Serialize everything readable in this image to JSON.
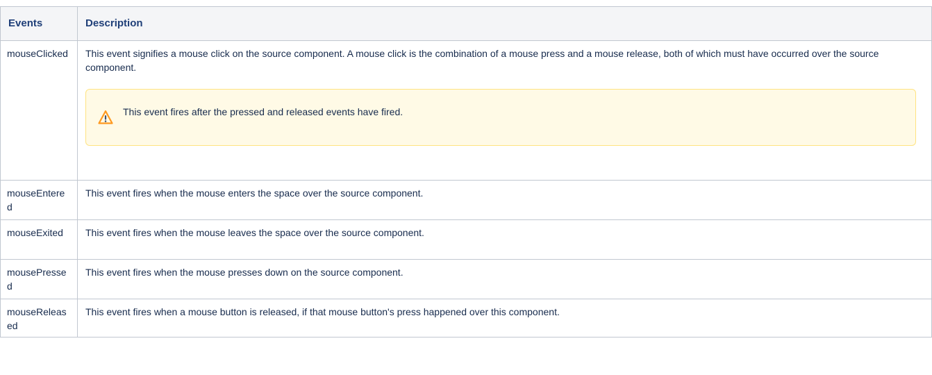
{
  "table": {
    "headers": {
      "events": "Events",
      "description": "Description"
    },
    "rows": [
      {
        "event": "mouseClicked",
        "description": "This event signifies a mouse click on the source component. A mouse click is the combination of a mouse press and a mouse release, both of which must have occurred over the source component.",
        "note": {
          "icon": "warning-icon",
          "text": "This event fires after the pressed and released events have fired."
        }
      },
      {
        "event": "mouseEntered",
        "description": "This event fires when the mouse enters the space over the source component."
      },
      {
        "event": "mouseExited",
        "description": "This event fires when the mouse leaves the space over the source component."
      },
      {
        "event": "mousePressed",
        "description": "This event fires when the mouse presses down on the source component."
      },
      {
        "event": "mouseReleased",
        "description": "This event fires when a mouse button is released, if that mouse button's press happened over this component."
      }
    ]
  },
  "colors": {
    "header_bg": "#f4f5f7",
    "header_text": "#1f3f78",
    "border": "#c1c7d0",
    "warning_bg": "#fffae6",
    "warning_border": "#ffe380",
    "warning_icon": "#ff991f"
  }
}
